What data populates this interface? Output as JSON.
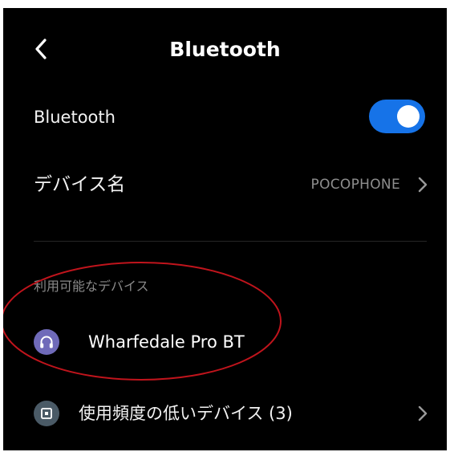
{
  "header": {
    "back_icon": "chevron-left-icon",
    "title": "Bluetooth"
  },
  "bluetooth_toggle": {
    "label": "Bluetooth",
    "enabled": true,
    "accent_color": "#1673e8"
  },
  "device_name": {
    "label": "デバイス名",
    "value": "POCOPHONE",
    "chevron_icon": "chevron-right-icon"
  },
  "available_devices": {
    "section_title": "利用可能なデバイス",
    "items": [
      {
        "name": "Wharfedale Pro BT",
        "icon": "headphones-icon",
        "icon_color": "#6f6ab9"
      }
    ]
  },
  "infrequent_devices": {
    "label": "使用頻度の低いデバイス (3)",
    "icon": "device-icon",
    "icon_color": "#4a5a66",
    "chevron_icon": "chevron-right-icon"
  },
  "annotation": {
    "shape": "ellipse",
    "color": "#c0141c"
  }
}
